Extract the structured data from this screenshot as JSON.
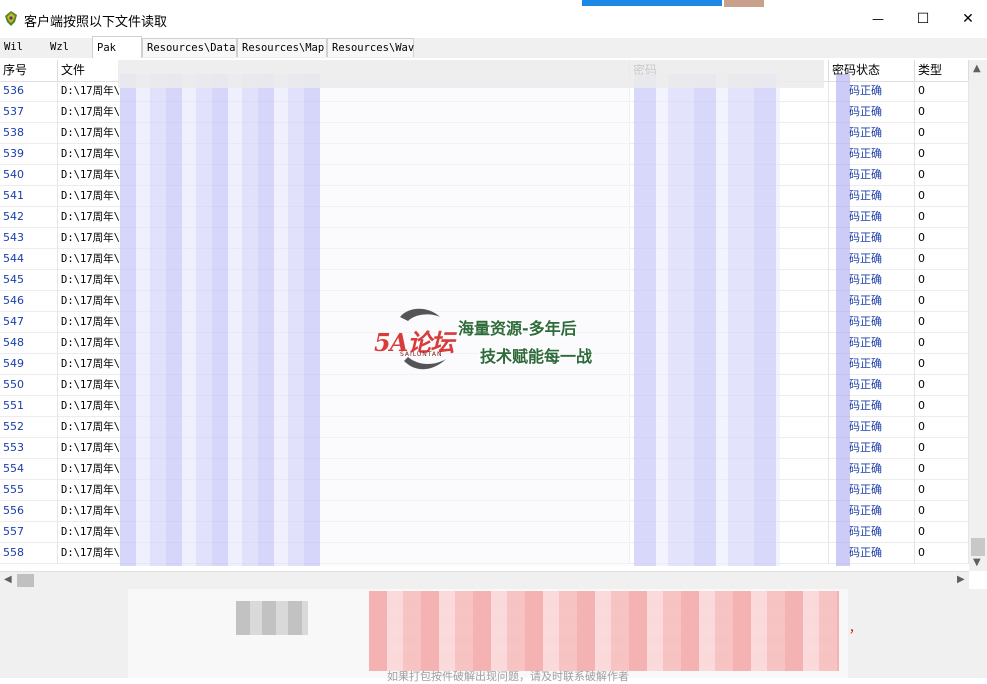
{
  "window": {
    "title": "客户端按照以下文件读取",
    "minimize_glyph": "—",
    "maximize_glyph": "☐",
    "close_glyph": "✕"
  },
  "tabs": [
    {
      "label": "Wil",
      "active": false
    },
    {
      "label": "Wzl",
      "active": false
    },
    {
      "label": "Pak",
      "active": true
    },
    {
      "label": "Resources\\Data",
      "active": false
    },
    {
      "label": "Resources\\Map",
      "active": false
    },
    {
      "label": "Resources\\Wav",
      "active": false
    }
  ],
  "table": {
    "headers": {
      "index": "序号",
      "file": "文件",
      "password": "密码",
      "status": "密码状态",
      "type": "类型"
    },
    "rows": [
      {
        "index": "536",
        "file": "D:\\17周年\\",
        "status": "码正确",
        "type": "0"
      },
      {
        "index": "537",
        "file": "D:\\17周年\\",
        "status": "码正确",
        "type": "0"
      },
      {
        "index": "538",
        "file": "D:\\17周年\\",
        "status": "码正确",
        "type": "0"
      },
      {
        "index": "539",
        "file": "D:\\17周年\\",
        "status": "码正确",
        "type": "0"
      },
      {
        "index": "540",
        "file": "D:\\17周年\\",
        "status": "码正确",
        "type": "0"
      },
      {
        "index": "541",
        "file": "D:\\17周年\\",
        "status": "码正确",
        "type": "0"
      },
      {
        "index": "542",
        "file": "D:\\17周年\\",
        "status": "码正确",
        "type": "0"
      },
      {
        "index": "543",
        "file": "D:\\17周年\\",
        "status": "码正确",
        "type": "0"
      },
      {
        "index": "544",
        "file": "D:\\17周年\\",
        "status": "码正确",
        "type": "0"
      },
      {
        "index": "545",
        "file": "D:\\17周年\\",
        "status": "码正确",
        "type": "0"
      },
      {
        "index": "546",
        "file": "D:\\17周年\\",
        "status": "码正确",
        "type": "0"
      },
      {
        "index": "547",
        "file": "D:\\17周年\\",
        "status": "码正确",
        "type": "0"
      },
      {
        "index": "548",
        "file": "D:\\17周年\\",
        "status": "码正确",
        "type": "0"
      },
      {
        "index": "549",
        "file": "D:\\17周年\\",
        "status": "码正确",
        "type": "0"
      },
      {
        "index": "550",
        "file": "D:\\17周年\\",
        "status": "码正确",
        "type": "0"
      },
      {
        "index": "551",
        "file": "D:\\17周年\\",
        "status": "码正确",
        "type": "0"
      },
      {
        "index": "552",
        "file": "D:\\17周年\\",
        "status": "码正确",
        "type": "0"
      },
      {
        "index": "553",
        "file": "D:\\17周年\\",
        "status": "码正确",
        "type": "0"
      },
      {
        "index": "554",
        "file": "D:\\17周年\\",
        "status": "码正确",
        "type": "0"
      },
      {
        "index": "555",
        "file": "D:\\17周年\\",
        "status": "码正确",
        "type": "0"
      },
      {
        "index": "556",
        "file": "D:\\17周年\\",
        "status": "码正确",
        "type": "0"
      },
      {
        "index": "557",
        "file": "D:\\17周年\\",
        "status": "码正确",
        "type": "0"
      },
      {
        "index": "558",
        "file": "D:\\17周年\\",
        "status": "码正确",
        "type": "0"
      }
    ]
  },
  "watermark": {
    "logo": "5A论坛",
    "logo_sub": "SAILUNTAN",
    "line1": "海量资源-多年后",
    "line2": "技术赋能每一战"
  },
  "bottom": {
    "trailing_comma": "，",
    "partial_text": "如果打包按件破解出现问题，请及时联系破解作者"
  },
  "colors": {
    "index_text": "#1a3ea8",
    "status_text": "#1a3ea8",
    "bottom_red": "#d00000"
  }
}
